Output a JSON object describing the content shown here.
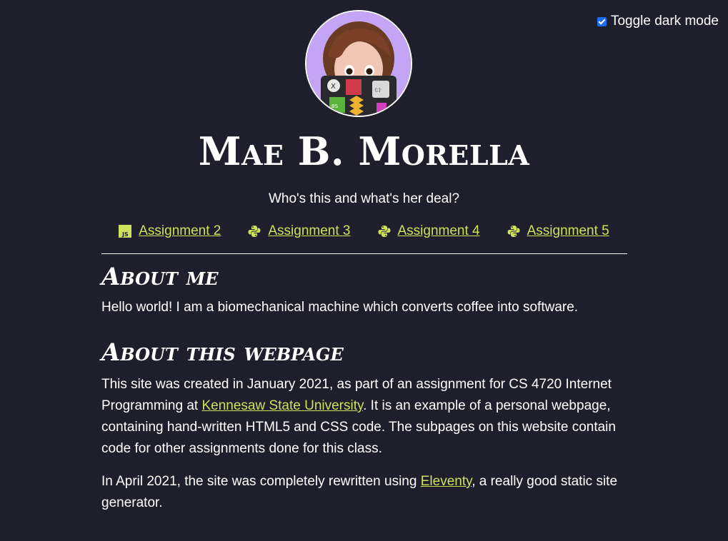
{
  "toggle": {
    "label": "Toggle dark mode",
    "checked": true
  },
  "avatar": {
    "icon": "memoji-avatar-icon"
  },
  "site": {
    "title": "Mae B. Morella",
    "tagline": "Who's this and what's her deal?"
  },
  "nav": {
    "items": [
      {
        "label": "Assignment 2",
        "icon": "javascript-icon"
      },
      {
        "label": "Assignment 3",
        "icon": "python-icon"
      },
      {
        "label": "Assignment 4",
        "icon": "python-icon"
      },
      {
        "label": "Assignment 5",
        "icon": "python-icon"
      }
    ]
  },
  "about_me": {
    "heading": "About me",
    "text": "Hello world! I am a biomechanical machine which converts coffee into software."
  },
  "about_page": {
    "heading": "About this webpage",
    "p1_before": "This site was created in January 2021, as part of an assignment for CS 4720 Internet Programming at ",
    "p1_link": "Kennesaw State University",
    "p1_after": ". It is an example of a personal webpage, containing hand-written HTML5 and CSS code. The subpages on this website contain code for other assignments done for this class.",
    "p2_before": "In April 2021, the site was completely rewritten using ",
    "p2_link": "Eleventy",
    "p2_after": ", a really good static site generator."
  },
  "colors": {
    "background": "#1f1e2c",
    "link": "#cfe05a",
    "text": "#ffffff"
  }
}
